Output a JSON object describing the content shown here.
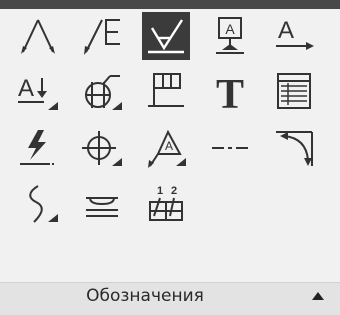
{
  "panel": {
    "title": "Обозначения",
    "accent_color": "#3b3b3b",
    "tools": [
      {
        "name": "angle-dimension-icon"
      },
      {
        "name": "leader-dimension-icon"
      },
      {
        "name": "surface-roughness-icon",
        "state": "selected"
      },
      {
        "name": "datum-target-icon"
      },
      {
        "name": "text-leader-icon"
      },
      {
        "name": "text-position-icon"
      },
      {
        "name": "cutting-plane-icon"
      },
      {
        "name": "frame-annotation-icon"
      },
      {
        "name": "text-icon",
        "glyph": "T"
      },
      {
        "name": "table-icon"
      },
      {
        "name": "weld-symbol-icon"
      },
      {
        "name": "centerline-target-icon"
      },
      {
        "name": "marking-leader-icon"
      },
      {
        "name": "axis-line-icon"
      },
      {
        "name": "arc-dimension-icon"
      },
      {
        "name": "break-line-icon"
      },
      {
        "name": "hatch-surface-icon"
      },
      {
        "name": "numbered-positions-icon",
        "labels": [
          "1",
          "2"
        ]
      }
    ]
  }
}
